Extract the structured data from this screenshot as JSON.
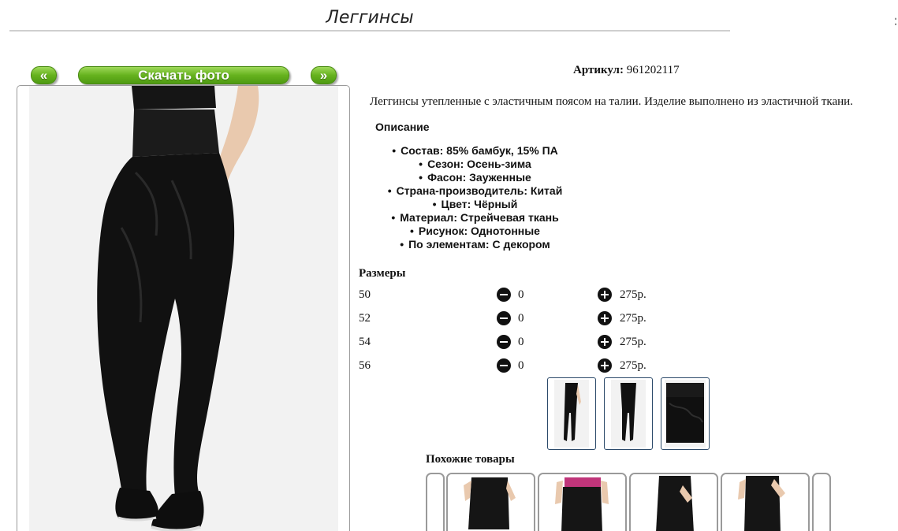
{
  "page": {
    "title": "Леггинсы"
  },
  "photo_nav": {
    "prev_label": "«",
    "download_label": "Скачать фото",
    "next_label": "»"
  },
  "product": {
    "article_label": "Артикул:",
    "article_value": "961202117",
    "description": "Леггинсы утепленные с эластичным поясом на талии. Изделие выполнено из эластичной ткани.",
    "description_heading": "Описание",
    "properties": [
      "Состав: 85% бамбук, 15% ПА",
      "Сезон: Осень-зима",
      "Фасон: Зауженные",
      "Страна-производитель: Китай",
      "Цвет: Чёрный",
      "Материал: Стрейчевая ткань",
      "Рисунок: Однотонные",
      "По элементам: С декором"
    ]
  },
  "sizes": {
    "heading": "Размеры",
    "rows": [
      {
        "size": "50",
        "qty": "0",
        "price": "275р."
      },
      {
        "size": "52",
        "qty": "0",
        "price": "275р."
      },
      {
        "size": "54",
        "qty": "0",
        "price": "275р."
      },
      {
        "size": "56",
        "qty": "0",
        "price": "275р."
      }
    ]
  },
  "similar": {
    "heading": "Похожие товары"
  },
  "icons": {
    "minus": "minus-circle-icon",
    "plus": "plus-circle-icon"
  },
  "colors": {
    "button_green": "#66b21e",
    "thumb_border": "#2c4a6a",
    "garment": "#111111"
  }
}
